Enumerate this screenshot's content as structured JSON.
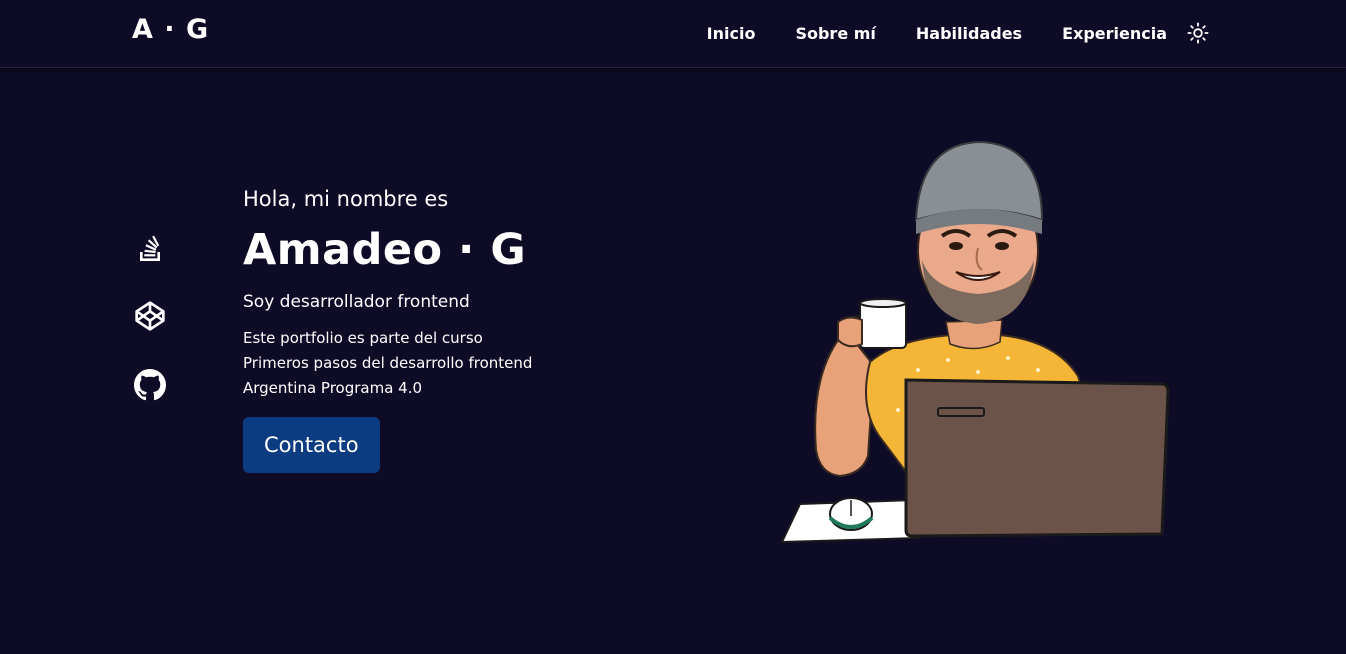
{
  "header": {
    "logo": "A · G",
    "nav": [
      {
        "label": "Inicio"
      },
      {
        "label": "Sobre mí"
      },
      {
        "label": "Habilidades"
      },
      {
        "label": "Experiencia"
      }
    ],
    "theme_icon": "sun-icon"
  },
  "social": [
    {
      "icon": "stack-overflow-icon"
    },
    {
      "icon": "codepen-icon"
    },
    {
      "icon": "github-icon"
    }
  ],
  "hero": {
    "greeting": "Hola, mi nombre es",
    "name": "Amadeo · G",
    "role": "Soy desarrollador frontend",
    "description": [
      "Este portfolio es parte del curso",
      "Primeros pasos del desarrollo frontend",
      "Argentina Programa 4.0"
    ],
    "cta_label": "Contacto"
  },
  "illustration": {
    "subject": "avatar-illustration"
  },
  "colors": {
    "background": "#0e0b27",
    "accent_button": "#0b3b80",
    "text": "#ffffff"
  }
}
